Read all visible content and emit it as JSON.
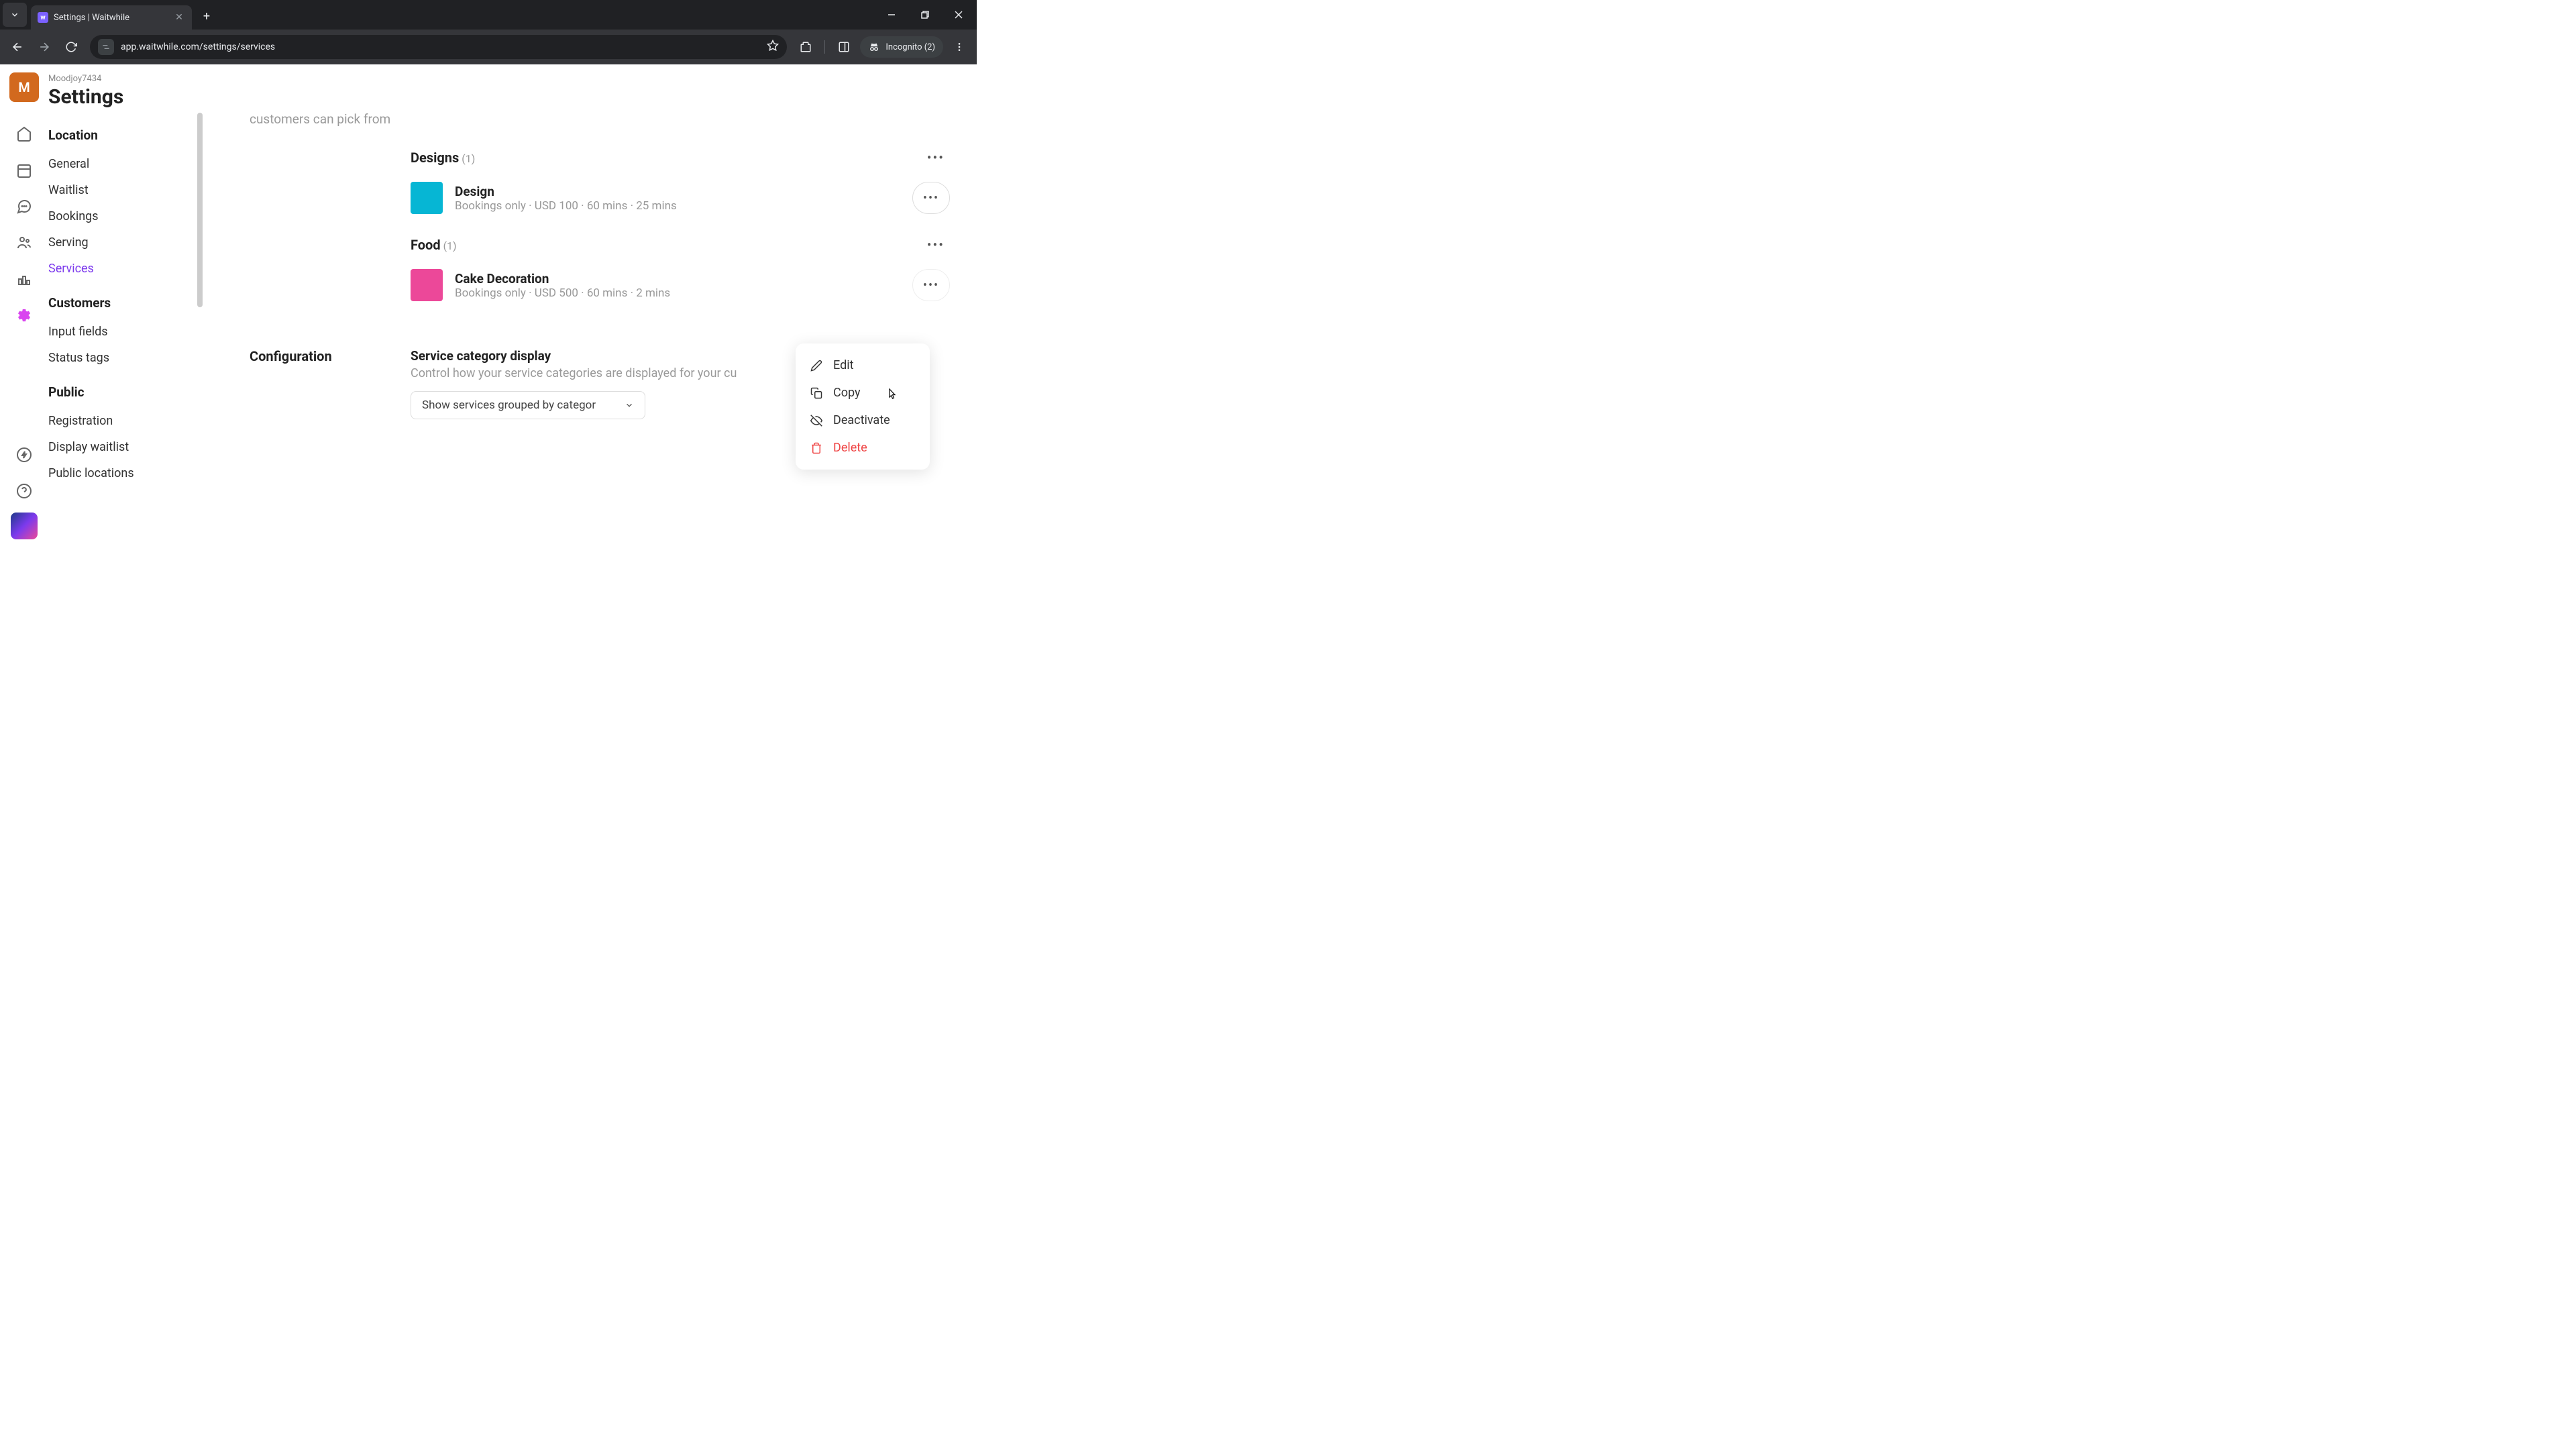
{
  "browser": {
    "tab_title": "Settings | Waitwhile",
    "url": "app.waitwhile.com/settings/services",
    "incognito_label": "Incognito (2)"
  },
  "header": {
    "workspace": "Moodjoy7434",
    "title": "Settings",
    "avatar_initial": "M"
  },
  "sidebar": {
    "sections": [
      {
        "heading": "Location",
        "items": [
          "General",
          "Waitlist",
          "Bookings",
          "Serving",
          "Services"
        ]
      },
      {
        "heading": "Customers",
        "items": [
          "Input fields",
          "Status tags"
        ]
      },
      {
        "heading": "Public",
        "items": [
          "Registration",
          "Display waitlist",
          "Public locations"
        ]
      }
    ],
    "active_item": "Services"
  },
  "main": {
    "partial_text": "customers can pick from",
    "categories": [
      {
        "name": "Designs",
        "count": "(1)",
        "services": [
          {
            "name": "Design",
            "meta": "Bookings only · USD 100 · 60 mins · 25 mins",
            "color": "cyan"
          }
        ]
      },
      {
        "name": "Food",
        "count": "(1)",
        "services": [
          {
            "name": "Cake Decoration",
            "meta": "Bookings only · USD 500 · 60 mins · 2 mins",
            "color": "pink"
          }
        ]
      }
    ],
    "configuration": {
      "label": "Configuration",
      "heading": "Service category display",
      "description": "Control how your service categories are displayed for your cu",
      "select_value": "Show services grouped by categor"
    }
  },
  "context_menu": {
    "items": [
      {
        "label": "Edit",
        "icon": "pencil"
      },
      {
        "label": "Copy",
        "icon": "copy"
      },
      {
        "label": "Deactivate",
        "icon": "eye-off"
      },
      {
        "label": "Delete",
        "icon": "trash",
        "danger": true
      }
    ]
  }
}
